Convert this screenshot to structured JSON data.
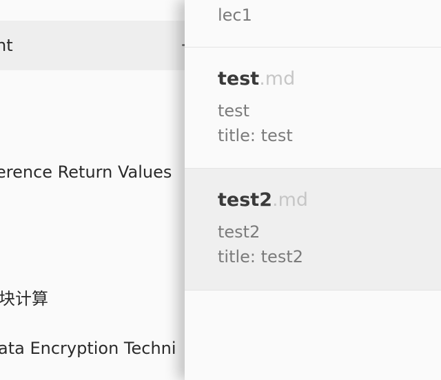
{
  "sidebar": {
    "items": [
      {
        "label": "nt",
        "active": true
      },
      {
        "label": "erence Return Values"
      },
      {
        "label": "块计算"
      },
      {
        "label": "ata Encryption Techni"
      }
    ]
  },
  "notes": [
    {
      "preview": "lec1"
    },
    {
      "name": "test",
      "ext": ".md",
      "preview": "test",
      "meta": "title: test"
    },
    {
      "name": "test2",
      "ext": ".md",
      "preview": "test2",
      "meta": "title: test2",
      "active": true
    }
  ]
}
